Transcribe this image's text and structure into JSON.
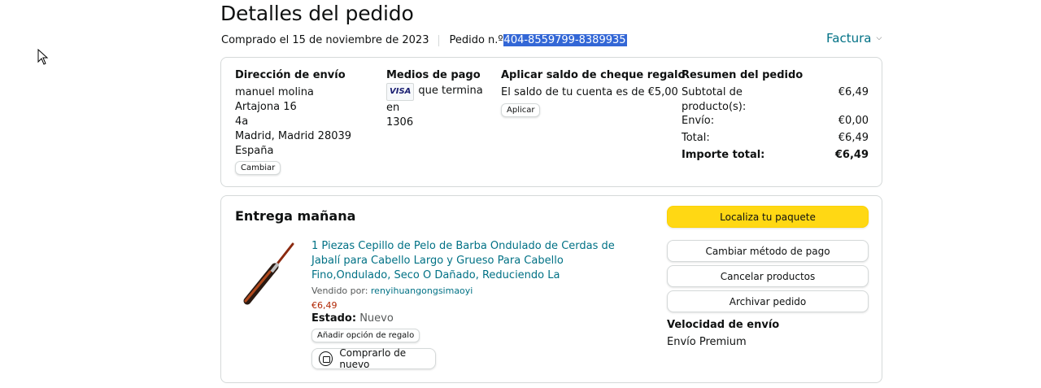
{
  "page": {
    "title": "Detalles del pedido",
    "purchased": "Comprado el 15 de noviembre de 2023",
    "order_label": "Pedido n.º",
    "order_number": "404-8559799-8389935",
    "invoice": "Factura"
  },
  "shipping": {
    "title": "Dirección de envío",
    "lines": [
      "manuel molina",
      "Artajona 16",
      "4a",
      "Madrid, Madrid 28039",
      "España"
    ],
    "change": "Cambiar"
  },
  "payment": {
    "title": "Medios de pago",
    "card_brand": "VISA",
    "ending": "que termina en",
    "last_digits": "1306"
  },
  "gift": {
    "title": "Aplicar saldo de cheque regalo",
    "balance": "El saldo de tu cuenta es de €5,00",
    "apply": "Aplicar"
  },
  "summary": {
    "title": "Resumen del pedido",
    "rows": [
      {
        "label": "Subtotal de producto(s):",
        "value": "€6,49"
      },
      {
        "label": "Envío:",
        "value": "€0,00"
      },
      {
        "label": "Total:",
        "value": "€6,49"
      },
      {
        "label": "Importe total:",
        "value": "€6,49"
      }
    ]
  },
  "delivery": {
    "title": "Entrega mañana",
    "product": "1 Piezas Cepillo de Pelo de Barba Ondulado de Cerdas de Jabalí para Cabello Largo y Grueso Para Cabello Fino,Ondulado, Seco O Dañado, Reduciendo La",
    "sold_by_label": "Vendido por:",
    "seller": "renyihuangongsimaoyi",
    "price": "€6,49",
    "status_label": "Estado:",
    "status_value": "Nuevo",
    "gift_option": "Añadir opción de regalo",
    "buy_again": "Comprarlo de nuevo",
    "actions": [
      "Localiza tu paquete",
      "Cambiar método de pago",
      "Cancelar productos",
      "Archivar pedido"
    ],
    "speed_title": "Velocidad de envío",
    "speed_value": "Envío Premium"
  },
  "colors": {
    "link": "#007185",
    "primary_button": "#FFD814",
    "price": "#B12704",
    "selection": "#3367D6"
  }
}
